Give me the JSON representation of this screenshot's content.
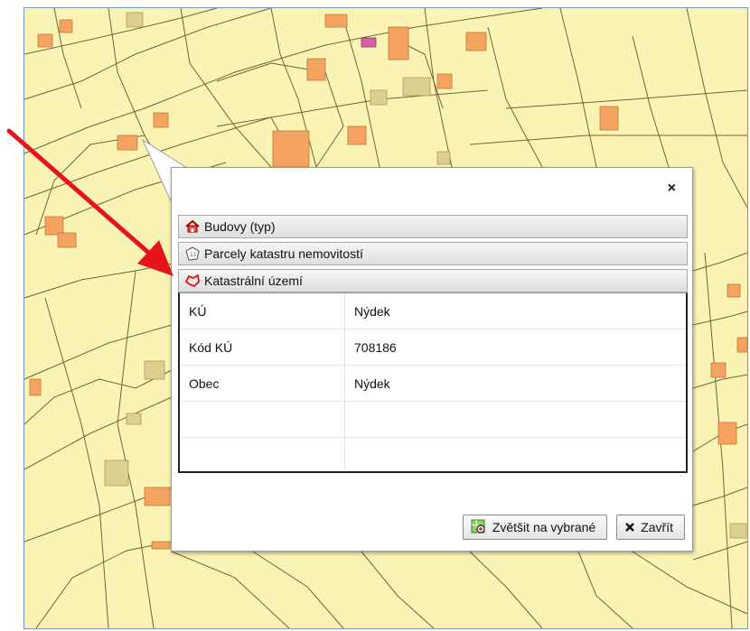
{
  "popup": {
    "close_label": "×",
    "sections": [
      {
        "label": "Budovy (typ)",
        "icon": "house-icon"
      },
      {
        "label": "Parcely katastru nemovitostí",
        "icon": "parcel-icon"
      },
      {
        "label": "Katastrální území",
        "icon": "territory-outline-icon"
      }
    ],
    "table": {
      "rows": [
        {
          "key": "KÚ",
          "value": "Nýdek"
        },
        {
          "key": "Kód KÚ",
          "value": "708186"
        },
        {
          "key": "Obec",
          "value": "Nýdek"
        },
        {
          "key": "",
          "value": ""
        },
        {
          "key": "",
          "value": ""
        }
      ]
    },
    "buttons": {
      "zoom_label": "Zvětšit na vybrané",
      "close_label": "Zavřít"
    }
  },
  "colors": {
    "map_bg": "#fbf3b4",
    "parcel_line": "#7a6f3a",
    "building": "#f4a460",
    "annotation_arrow": "#e8141c"
  }
}
